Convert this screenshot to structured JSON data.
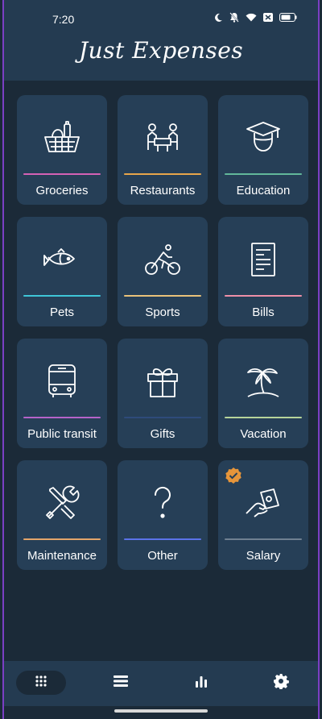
{
  "status_bar": {
    "time": "7:20",
    "icons": [
      "moon-icon",
      "bell-off-icon",
      "wifi-icon",
      "battery-saver-icon",
      "battery-icon"
    ]
  },
  "app": {
    "title": "Just Expenses"
  },
  "colors": {
    "background": "#1b2a38",
    "header": "#243b51",
    "tile": "#263f57",
    "badge": "#e6953a"
  },
  "categories": [
    {
      "label": "Groceries",
      "icon": "grocery-basket-icon",
      "accent": "#d562b5"
    },
    {
      "label": "Restaurants",
      "icon": "restaurant-table-icon",
      "accent": "#e8a64a"
    },
    {
      "label": "Education",
      "icon": "graduation-cap-icon",
      "accent": "#62b89a"
    },
    {
      "label": "Pets",
      "icon": "fish-icon",
      "accent": "#3fc6d8"
    },
    {
      "label": "Sports",
      "icon": "cyclist-icon",
      "accent": "#e9c27a"
    },
    {
      "label": "Bills",
      "icon": "bill-document-icon",
      "accent": "#ee8fa8"
    },
    {
      "label": "Public transit",
      "icon": "bus-icon",
      "accent": "#b563c9"
    },
    {
      "label": "Gifts",
      "icon": "gift-icon",
      "accent": "#2e4b7a"
    },
    {
      "label": "Vacation",
      "icon": "palm-tree-icon",
      "accent": "#b6d49a"
    },
    {
      "label": "Maintenance",
      "icon": "tools-icon",
      "accent": "#e3a56a"
    },
    {
      "label": "Other",
      "icon": "question-mark-icon",
      "accent": "#5b73e8"
    },
    {
      "label": "Salary",
      "icon": "money-hand-icon",
      "accent": "#6f8091",
      "selected": true
    }
  ],
  "bottom_nav": {
    "items": [
      {
        "name": "categories",
        "icon": "grid-icon",
        "active": true
      },
      {
        "name": "list",
        "icon": "list-icon",
        "active": false
      },
      {
        "name": "statistics",
        "icon": "bar-chart-icon",
        "active": false
      },
      {
        "name": "settings",
        "icon": "gear-icon",
        "active": false
      }
    ]
  }
}
